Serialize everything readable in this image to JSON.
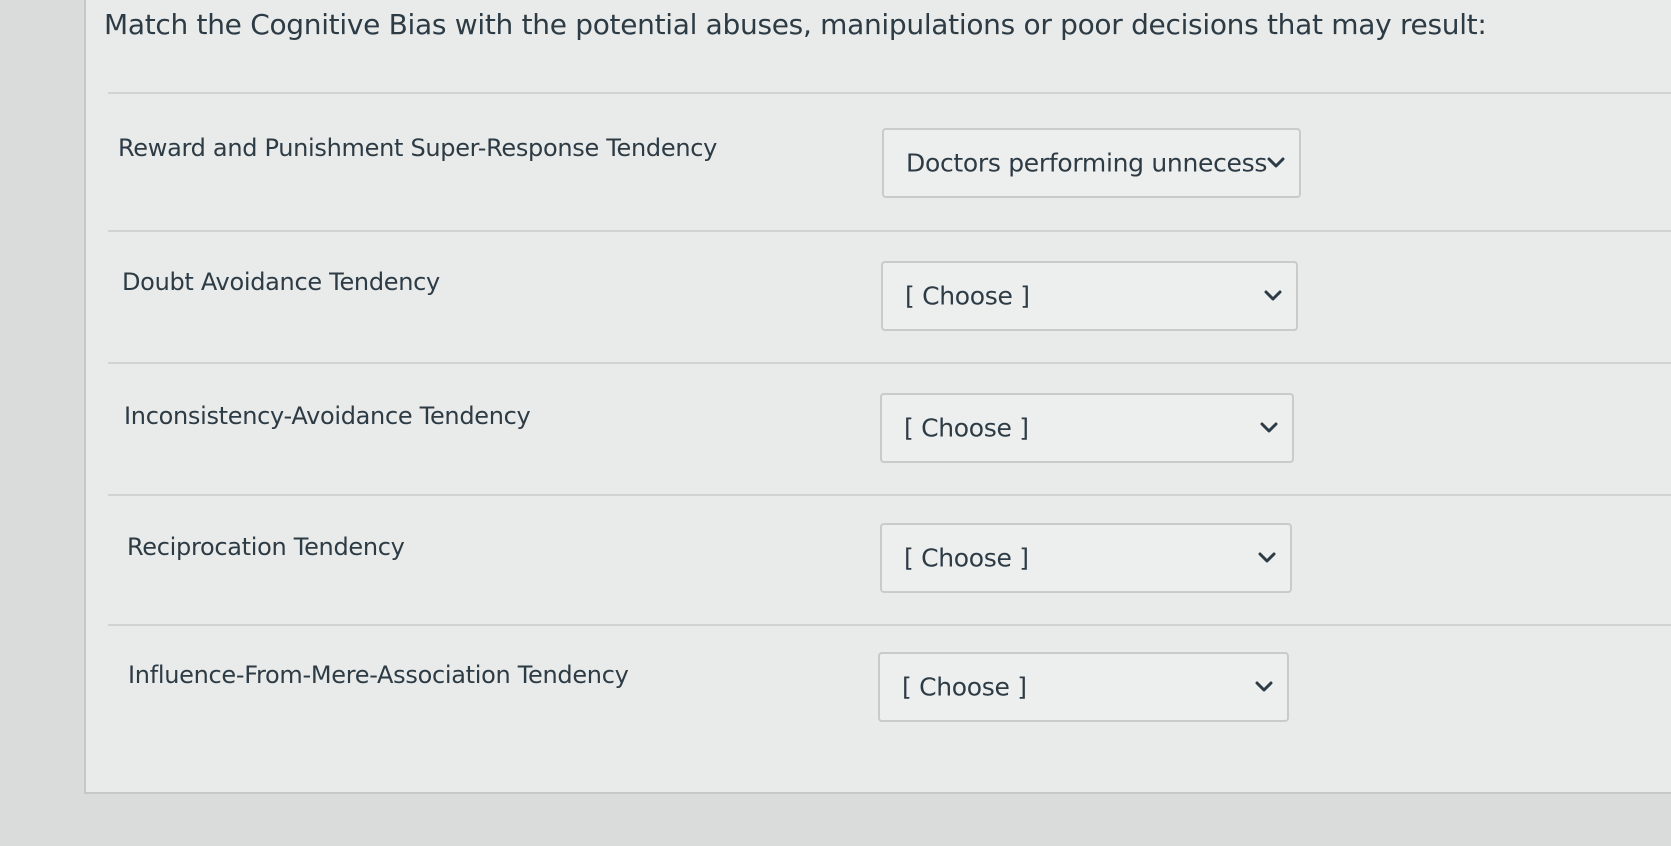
{
  "question": {
    "prompt": "Match the Cognitive Bias with the potential abuses, manipulations or poor decisions that may result:"
  },
  "rows": [
    {
      "label": "Reward and Punishment Super-Response Tendency",
      "selected": "Doctors performing unnecess"
    },
    {
      "label": "Doubt Avoidance Tendency",
      "selected": "[ Choose ]"
    },
    {
      "label": "Inconsistency-Avoidance Tendency",
      "selected": "[ Choose ]"
    },
    {
      "label": "Reciprocation Tendency",
      "selected": "[ Choose ]"
    },
    {
      "label": "Influence-From-Mere-Association Tendency",
      "selected": "[ Choose ]"
    }
  ],
  "icons": {
    "dropdown": "chevron-down-icon"
  },
  "colors": {
    "text": "#2d3b45",
    "background": "#e9ebea",
    "border": "#c7cbca"
  }
}
